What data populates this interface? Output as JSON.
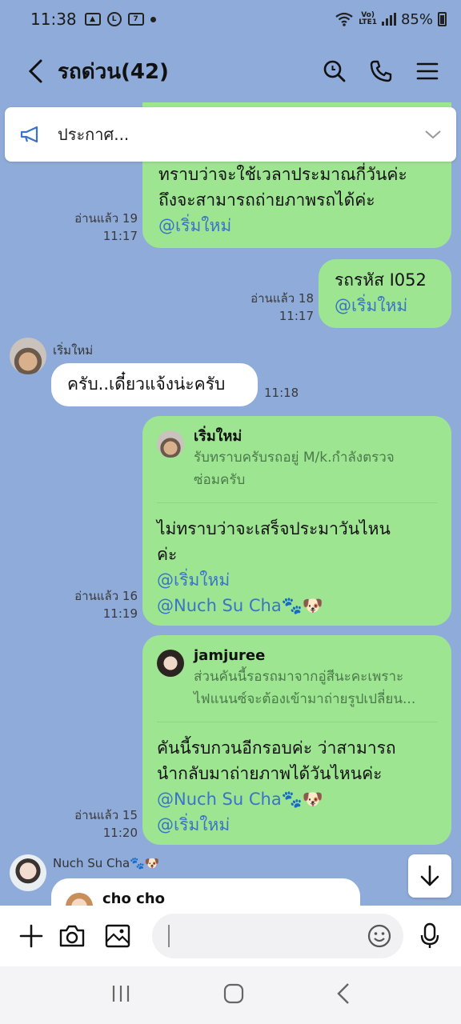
{
  "status": {
    "time": "11:38",
    "battery": "85%",
    "network": "LTE1"
  },
  "header": {
    "title": "รถด่วน(42)"
  },
  "announcement": {
    "text": "ประกาศ..."
  },
  "messages": {
    "m1": {
      "lines": [
        "ทราบว่าจะใช้เวลาประมาณกี่วันค่ะ",
        "ถึงจะสามารถถ่ายภาพรถได้ค่ะ"
      ],
      "mention": "@เริ่มใหม่",
      "read": "อ่านแล้ว 19",
      "time": "11:17"
    },
    "m2": {
      "text": "รถรหัส I052",
      "mention": "@เริ่มใหม่",
      "read": "อ่านแล้ว 18",
      "time": "11:17"
    },
    "m3": {
      "sender": "เริ่มใหม่",
      "text": "ครับ..เดี๋ยวแจ้งน่ะครับ",
      "time": "11:18"
    },
    "m4": {
      "quote_name": "เริ่มใหม่",
      "quote_lines": [
        "รับทราบครับรถอยู่ M/k.กำลังตรวจ",
        "ซ่อมครับ"
      ],
      "lines": [
        "ไม่ทราบว่าจะเสร็จประมาวันไหน",
        "ค่ะ"
      ],
      "mention1": "@เริ่มใหม่",
      "mention2": "@Nuch Su Cha🐾🐶",
      "read": "อ่านแล้ว 16",
      "time": "11:19"
    },
    "m5": {
      "quote_name": "jamjuree",
      "quote_lines": [
        "ส่วนคันนี้รอรถมาจากอู่สีนะคะเพราะ",
        "ไฟแนนซ์จะต้องเข้ามาถ่ายรูปเปลี่ยน..."
      ],
      "lines": [
        "คันนี้รบกวนอีกรอบค่ะ ว่าสามารถ",
        "นำกลับมาถ่ายภาพได้วันไหนค่ะ"
      ],
      "mention1": "@Nuch Su Cha🐾🐶",
      "mention2": "@เริ่มใหม่",
      "read": "อ่านแล้ว 15",
      "time": "11:20"
    },
    "m6": {
      "sender": "Nuch Su Cha🐾🐶",
      "quote_name": "cho cho"
    }
  },
  "input": {
    "placeholder": ""
  }
}
